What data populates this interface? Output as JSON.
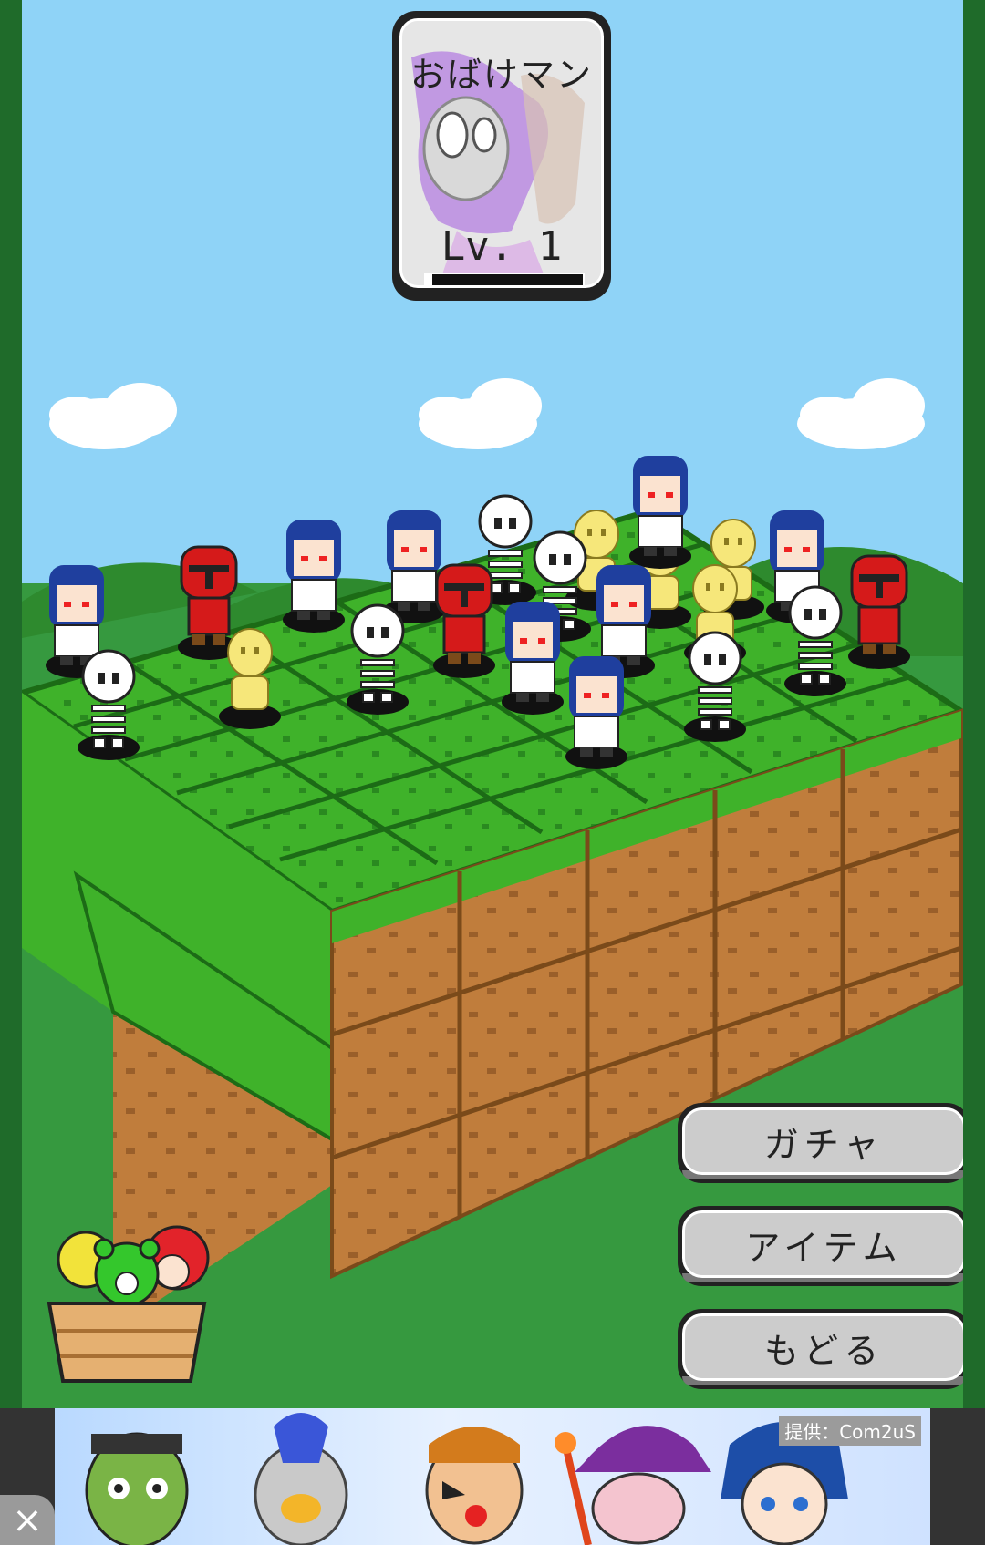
{
  "character_card": {
    "name": "おばけマン",
    "level": "Lv. 1",
    "xp_progress": 0.04
  },
  "buttons": {
    "gacha": "ガチャ",
    "item": "アイテム",
    "back": "もどる"
  },
  "ad": {
    "provider": "提供：Com2uS",
    "close_icon": "×"
  },
  "colors": {
    "sky": "#8fd3f7",
    "grass": "#3fb22a",
    "dirt": "#c07d3c",
    "frame": "#1f6b2a"
  }
}
